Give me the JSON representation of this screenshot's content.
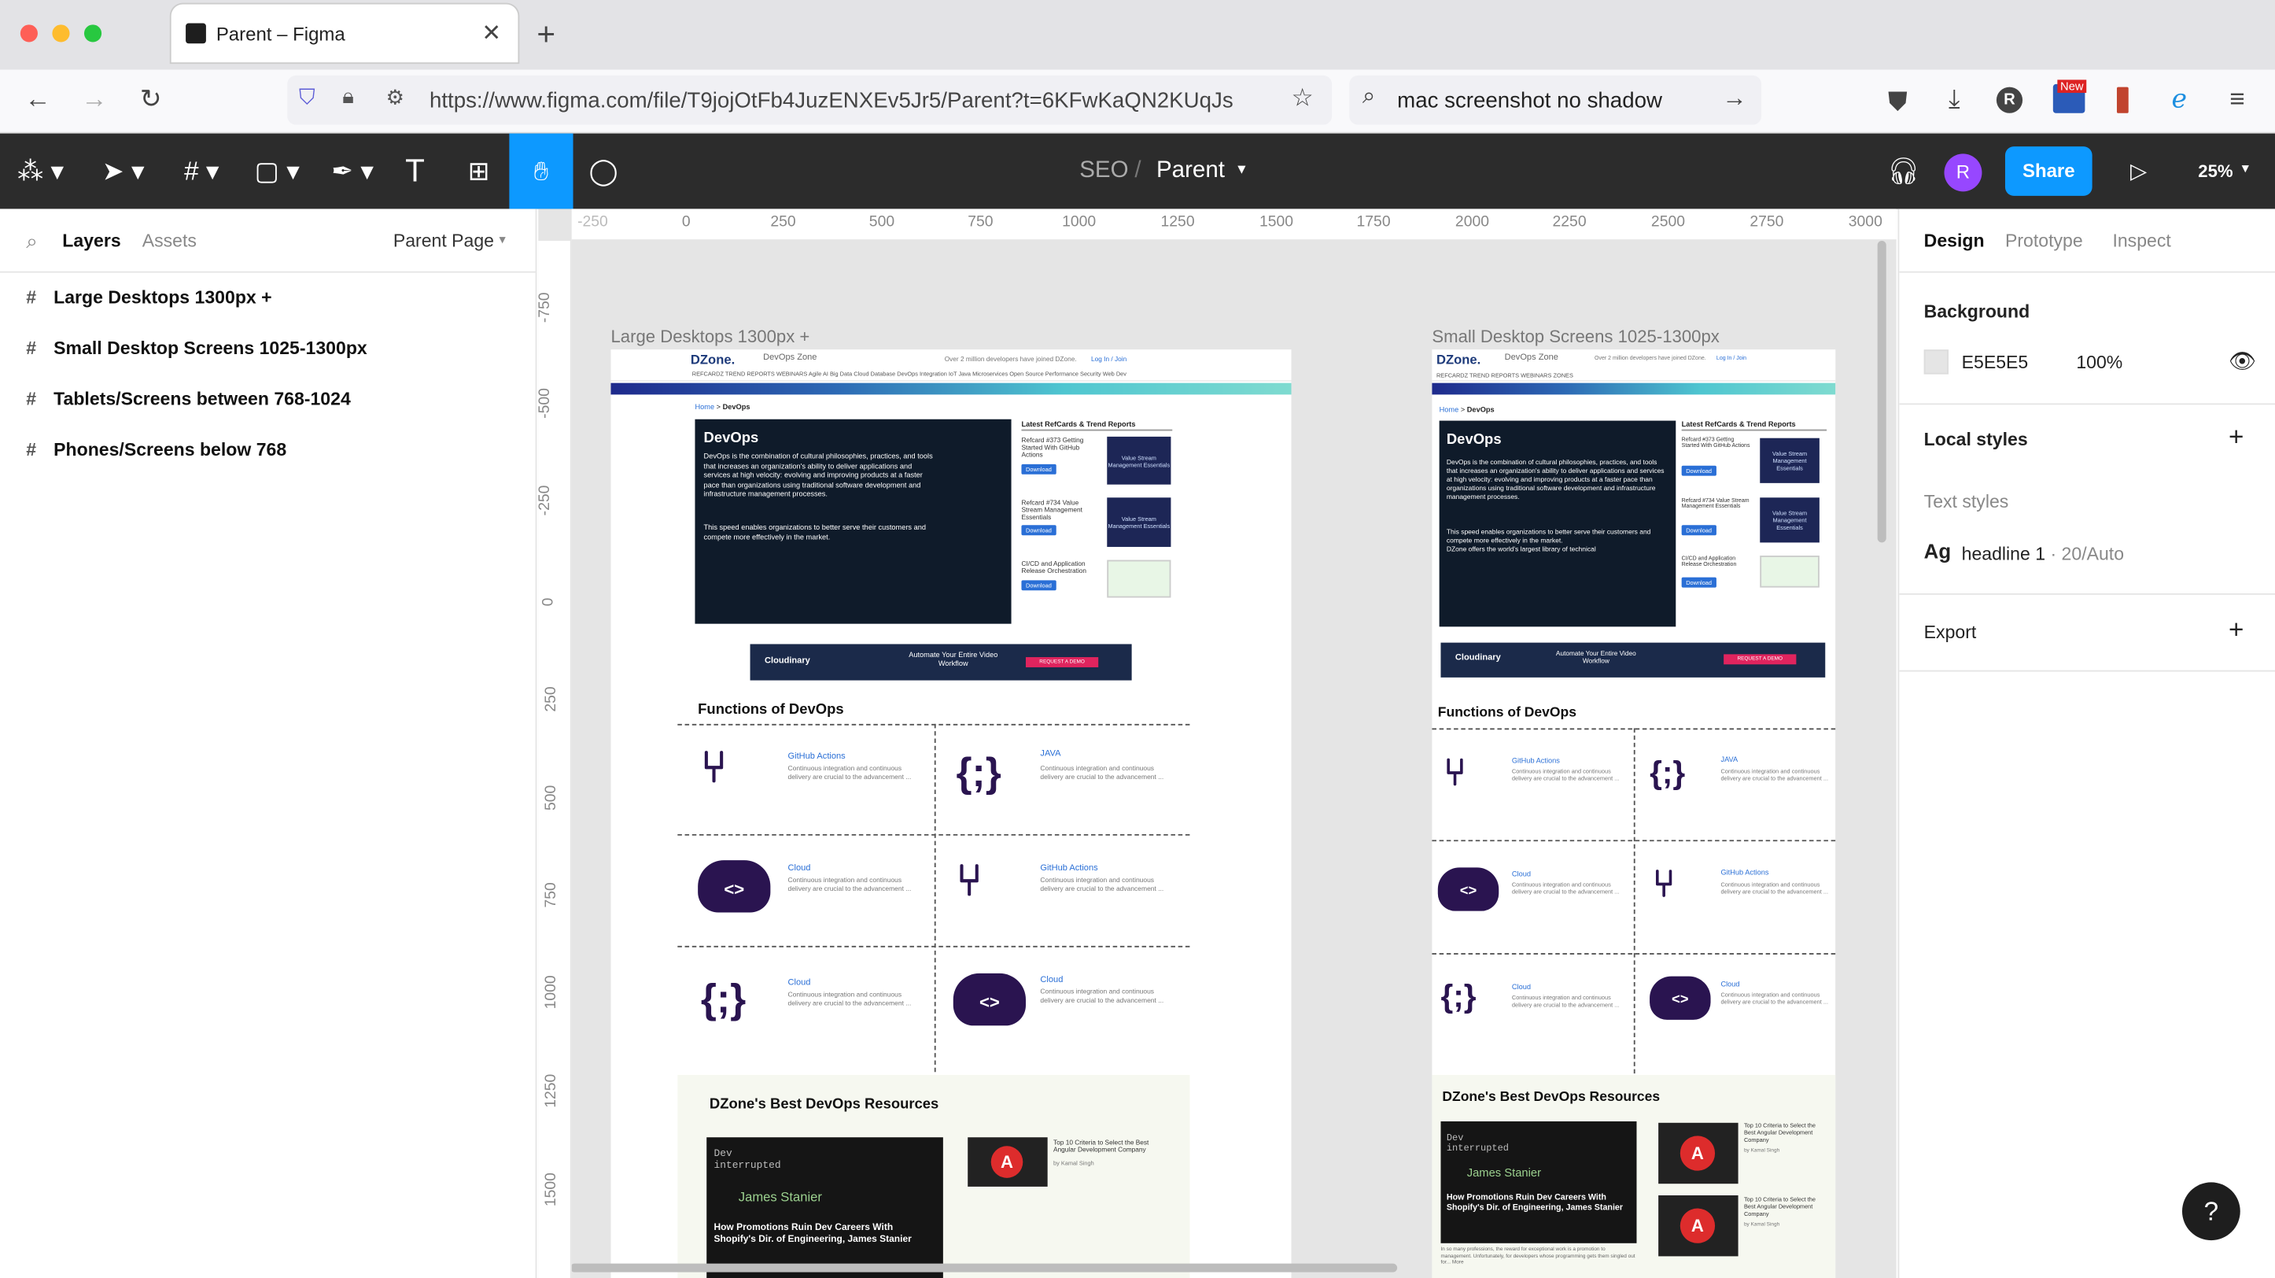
{
  "browser": {
    "tab_title": "Parent – Figma",
    "url": "https://www.figma.com/file/T9jojOtFb4JuzENXEv5Jr5/Parent?t=6KFwKaQN2KUqJs",
    "search_text": "mac screenshot no shadow",
    "avatar_letter": "R",
    "new_badge": "New"
  },
  "figma": {
    "breadcrumb_team": "SEO",
    "breadcrumb_sep": "/",
    "file_name": "Parent",
    "user_avatar": "R",
    "share_label": "Share",
    "zoom": "25%"
  },
  "left_panel": {
    "tab_layers": "Layers",
    "tab_assets": "Assets",
    "page_name": "Parent Page",
    "layers": [
      "Large Desktops 1300px +",
      "Small Desktop Screens 1025-1300px",
      "Tablets/Screens between 768-1024",
      "Phones/Screens below 768"
    ]
  },
  "rulers": {
    "h": [
      "-250",
      "0",
      "250",
      "500",
      "750",
      "1000",
      "1250",
      "1500",
      "1750",
      "2000",
      "2250",
      "2500",
      "2750",
      "3000"
    ],
    "v": [
      "-750",
      "-500",
      "-250",
      "0",
      "250",
      "500",
      "750",
      "1000",
      "1250",
      "1500"
    ]
  },
  "right_panel": {
    "tab_design": "Design",
    "tab_prototype": "Prototype",
    "tab_inspect": "Inspect",
    "background_label": "Background",
    "bg_hex": "E5E5E5",
    "bg_opacity": "100%",
    "local_styles": "Local styles",
    "text_styles": "Text styles",
    "style_ag": "Ag",
    "style_name": "headline 1",
    "style_meta": " · 20/Auto",
    "export_label": "Export"
  },
  "frames": {
    "large_title": "Large Desktops 1300px +",
    "small_title": "Small Desktop Screens 1025-1300px",
    "dz_logo": "DZone.",
    "dz_zone": "DevOps Zone",
    "dz_joined": "Over 2 million developers have joined DZone.",
    "dz_login": "Log In / Join",
    "nav_items": "REFCARDZ   TREND REPORTS   WEBINARS   Agile  AI  Big Data  Cloud  Database  DevOps  Integration  IoT  Java  Microservices  Open Source  Performance  Security  Web Dev",
    "nav_items_small": "REFCARDZ   TREND REPORTS   WEBINARS   ZONES",
    "crumb_home": "Home",
    "crumb_devops": "DevOps",
    "hero_title": "DevOps",
    "hero_text": "DevOps is the combination of cultural philosophies, practices, and tools that increases an organization's ability to deliver applications and services at high velocity: evolving and improving products at a faster pace than organizations using traditional software development and infrastructure management processes.",
    "hero_text2": "This speed enables organizations to better serve their customers and compete more effectively in the market.",
    "hero_text3": "DZone offers the world's largest library of technical",
    "refcards_title": "Latest RefCards & Trend Reports",
    "refcard_1": "Refcard #373 Getting Started With GitHub Actions",
    "refcard_2": "Refcard #734 Value Stream Management Essentials",
    "refcard_3": "CI/CD and Application Release Orchestration",
    "download": "Download",
    "vsm_thumb": "Value Stream Management Essentials",
    "ad_brand": "Cloudinary",
    "ad_text": "Automate Your Entire Video Workflow",
    "ad_cta": "REQUEST A DEMO",
    "functions_title": "Functions of DevOps",
    "cells": [
      {
        "icon": "git-branch",
        "title": "GitHub Actions"
      },
      {
        "icon": "braces",
        "title": "JAVA"
      },
      {
        "icon": "cloud-code",
        "title": "Cloud"
      },
      {
        "icon": "git-branch",
        "title": "GitHub Actions"
      },
      {
        "icon": "braces",
        "title": "Cloud"
      },
      {
        "icon": "cloud-code",
        "title": "Cloud"
      }
    ],
    "cell_desc": "Continuous integration and continuous delivery are crucial to the advancement ...",
    "more": "more",
    "resources_title": "DZone's Best DevOps Resources",
    "dev_interrupted": "Dev interrupted",
    "james": "James Stanier",
    "podcast_title": "How Promotions Ruin Dev Careers With Shopify's Dir. of Engineering, James Stanier",
    "angular_title": "Top 10 Criteria to Select the Best Angular Development Company",
    "angular_author": "by Kamal Singh",
    "small_caption": "In so many professions, the reward for exceptional work is a promotion to management. Unfortunately, for developers whose programming gets them singled out for... More"
  },
  "help": "?"
}
